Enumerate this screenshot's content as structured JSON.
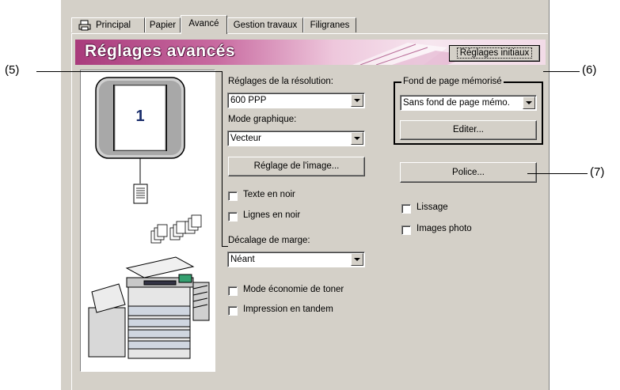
{
  "tabs": [
    {
      "label": "Principal"
    },
    {
      "label": "Papier"
    },
    {
      "label": "Avancé"
    },
    {
      "label": "Gestion travaux"
    },
    {
      "label": "Filigranes"
    }
  ],
  "banner": {
    "title": "Réglages avancés",
    "reset_button": "Réglages initiaux"
  },
  "preview": {
    "page_number": "1"
  },
  "resolution": {
    "label": "Réglages de la résolution:",
    "value": "600 PPP"
  },
  "graphic_mode": {
    "label": "Mode graphique:",
    "value": "Vecteur"
  },
  "image_button": "Réglage de l'image...",
  "text_black": "Texte en noir",
  "lines_black": "Lignes en noir",
  "margin_shift": {
    "label": "Décalage de marge:",
    "value": "Néant"
  },
  "toner_save": "Mode économie de toner",
  "tandem": "Impression en tandem",
  "overlay": {
    "label": "Fond de page mémorisé",
    "value": "Sans fond de page mémo.",
    "edit_button": "Editer..."
  },
  "font_button": "Police...",
  "smoothing": "Lissage",
  "photo": "Images photo",
  "callouts": {
    "c5": "(5)",
    "c6": "(6)",
    "c7": "(7)"
  }
}
